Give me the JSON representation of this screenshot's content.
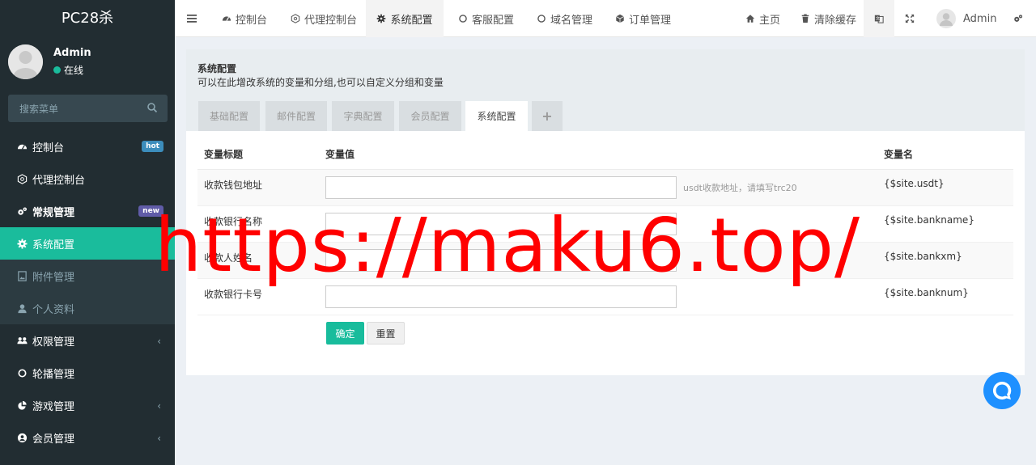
{
  "app": {
    "logo": "PC28杀"
  },
  "user": {
    "name": "Admin",
    "status": "在线"
  },
  "sidebar": {
    "search_placeholder": "搜索菜单",
    "items": [
      {
        "label": "控制台",
        "icon": "dashboard-icon",
        "badge": "hot"
      },
      {
        "label": "代理控制台",
        "icon": "gauge-icon"
      },
      {
        "label": "常规管理",
        "icon": "cogs-icon",
        "badge": "new"
      },
      {
        "label": "系统配置",
        "icon": "gear-icon"
      },
      {
        "label": "附件管理",
        "icon": "file-image-icon"
      },
      {
        "label": "个人资料",
        "icon": "user-icon"
      },
      {
        "label": "权限管理",
        "icon": "group-icon"
      },
      {
        "label": "轮播管理",
        "icon": "circle-icon"
      },
      {
        "label": "游戏管理",
        "icon": "pie-icon"
      },
      {
        "label": "会员管理",
        "icon": "user-circle-icon"
      }
    ]
  },
  "navbar": {
    "tabs": [
      {
        "label": "控制台",
        "icon": "dashboard-icon"
      },
      {
        "label": "代理控制台",
        "icon": "gauge-icon"
      },
      {
        "label": "系统配置",
        "icon": "gear-icon"
      },
      {
        "label": "客服配置",
        "icon": "circle-icon"
      },
      {
        "label": "域名管理",
        "icon": "circle-icon"
      },
      {
        "label": "订单管理",
        "icon": "cube-icon"
      }
    ],
    "home": "主页",
    "clear_cache": "清除缓存",
    "admin": "Admin"
  },
  "panel": {
    "title": "系统配置",
    "desc": "可以在此增改系统的变量和分组,也可以自定义分组和变量",
    "tabs": [
      "基础配置",
      "邮件配置",
      "字典配置",
      "会员配置",
      "系统配置",
      "+"
    ]
  },
  "table": {
    "headers": [
      "变量标题",
      "变量值",
      "",
      "变量名"
    ],
    "rows": [
      {
        "title": "收款钱包地址",
        "value": "",
        "hint": "usdt收款地址，请填写trc20",
        "var": "{$site.usdt}"
      },
      {
        "title": "收款银行名称",
        "value": "",
        "hint": "",
        "var": "{$site.bankname}"
      },
      {
        "title": "收款人姓名",
        "value": "",
        "hint": "",
        "var": "{$site.bankxm}"
      },
      {
        "title": "收款银行卡号",
        "value": "",
        "hint": "",
        "var": "{$site.banknum}"
      }
    ]
  },
  "buttons": {
    "ok": "确定",
    "reset": "重置"
  },
  "watermark": "https://maku6.top/",
  "colors": {
    "sidebar": "#222d32",
    "accent": "#1abc9c",
    "watermark": "#ff0000",
    "chat": "#1e90ff"
  }
}
